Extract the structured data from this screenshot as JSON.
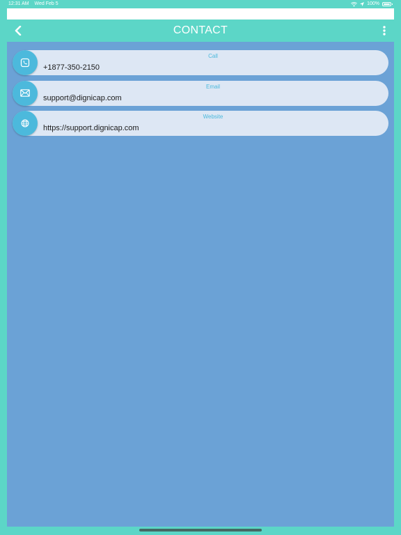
{
  "status_bar": {
    "time": "12:31 AM",
    "date": "Wed Feb 5",
    "battery": "100%"
  },
  "header": {
    "title": "CONTACT"
  },
  "contacts": [
    {
      "label": "Call",
      "value": "+1877-350-2150",
      "icon": "phone-icon"
    },
    {
      "label": "Email",
      "value": "support@dignicap.com",
      "icon": "mail-icon"
    },
    {
      "label": "Website",
      "value": "https://support.dignicap.com",
      "icon": "globe-icon"
    }
  ],
  "colors": {
    "header_bg": "#5cd6c7",
    "body_bg": "#6ba2d6",
    "item_bg": "#dde7f4",
    "icon_circle": "#4cb9dc"
  }
}
